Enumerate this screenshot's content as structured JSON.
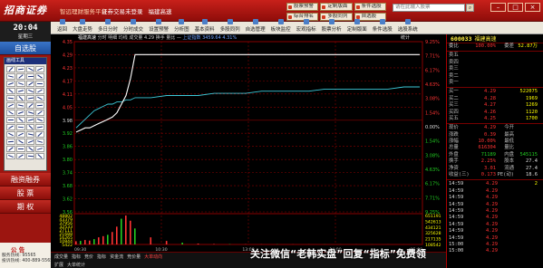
{
  "titlebar": {
    "logo": "招商证券",
    "subtitle": "智远理财服务平台",
    "menu": [
      "证券交易未登录",
      "福建高速"
    ],
    "quick_buttons": [
      "股票预警",
      "定制版面",
      "条件选股",
      "综合排名",
      "多股同列",
      "自选股"
    ],
    "search_placeholder": "请在此输入股票",
    "search_icon": "search-icon",
    "window_controls": [
      "min-icon",
      "max-icon",
      "close-icon"
    ]
  },
  "clock": {
    "time": "20:04",
    "day": "星期三"
  },
  "leftnav": {
    "top_item": "自选股",
    "tool_panel_title": "画线工具",
    "items": [
      "融资融券",
      "股 票",
      "期 权"
    ],
    "notice_title": "公 告",
    "phones": [
      "服务热线: 95565",
      "投诉热线: 400-889-5565"
    ]
  },
  "toolbar": {
    "items": [
      "返回",
      "大盘走势",
      "多日分时",
      "分时成交",
      "设置预警",
      "分析图",
      "基本资料",
      "多股同列",
      "自选管理",
      "板块监控",
      "宏观指标",
      "股票分析",
      "定制版面",
      "条件选股",
      "选股系统"
    ]
  },
  "chart_header": {
    "name": "福建高速",
    "mode": "分时 明细",
    "info": "均线 成交量 4.29 换手 量比 —",
    "index": "上证指数 3459.64 4.31%",
    "right_label": "统计"
  },
  "chart_data": {
    "type": "line",
    "title": "",
    "price_axis": [
      "4.35",
      "4.29",
      "4.23",
      "4.17",
      "4.11",
      "4.05",
      "3.98",
      "3.92",
      "3.86",
      "3.80",
      "3.74",
      "3.68",
      "3.62",
      "3.56"
    ],
    "pct_axis": [
      "9.25%",
      "7.71%",
      "6.17%",
      "4.63%",
      "3.08%",
      "1.54%",
      "0.00%",
      "1.54%",
      "3.08%",
      "4.63%",
      "6.17%",
      "7.71%",
      "9.25%"
    ],
    "volume_axis_left": [
      "48802",
      "43379",
      "37956",
      "32533",
      "27111",
      "21688",
      "16265",
      "10844",
      "5422"
    ],
    "volume_axis_right": [
      "651191",
      "542613",
      "434121",
      "325628",
      "217135",
      "108542"
    ],
    "x_labels": [
      "09:30",
      "10:30",
      "13:00",
      "14:00",
      "15:00"
    ],
    "prev_close": 3.98,
    "price_series": [
      3.93,
      3.94,
      3.95,
      3.95,
      3.96,
      3.97,
      3.98,
      3.99,
      4.0,
      4.02,
      4.06,
      4.1,
      4.18,
      4.29,
      4.29,
      4.29,
      4.29,
      4.29,
      4.29,
      4.29,
      4.29,
      4.29,
      4.29,
      4.29,
      4.29,
      4.29,
      4.29,
      4.29,
      4.29,
      4.29,
      4.29,
      4.29
    ],
    "avg_series": [
      3.95,
      3.97,
      3.99,
      4.01,
      4.03,
      4.04,
      4.05,
      4.06,
      4.06,
      4.07,
      4.07,
      4.08,
      4.08,
      4.09,
      4.09,
      4.1,
      4.1,
      4.1,
      4.11,
      4.11,
      4.11,
      4.12,
      4.12,
      4.12,
      4.12,
      4.13,
      4.13,
      4.13,
      4.13,
      4.13,
      4.14,
      4.14
    ],
    "volume_series": [
      5422,
      6000,
      7500,
      6500,
      9000,
      12000,
      14000,
      16265,
      21000,
      30000,
      43379,
      48802,
      40000,
      27000,
      12000,
      6000,
      3000,
      1500,
      800,
      500,
      400,
      300,
      300,
      200,
      200,
      200,
      150,
      150,
      150,
      100,
      100,
      100
    ]
  },
  "bottom_tabs": {
    "row1": [
      "成交量",
      "指标",
      "竞价",
      "指标",
      "资金流",
      "竞价量",
      "大单动向"
    ],
    "row2": [
      "扩展",
      "大单统计"
    ]
  },
  "quote": {
    "code": "600033",
    "name": "福建高速",
    "header_rows": [
      {
        "label": "委比",
        "value": "100.00%",
        "qty_label": "委差",
        "qty": "52.87万"
      }
    ],
    "sell": [
      {
        "label": "卖五",
        "price": "",
        "qty": ""
      },
      {
        "label": "卖四",
        "price": "",
        "qty": ""
      },
      {
        "label": "卖三",
        "price": "",
        "qty": ""
      },
      {
        "label": "卖二",
        "price": "",
        "qty": ""
      },
      {
        "label": "卖一",
        "price": "",
        "qty": ""
      }
    ],
    "buy": [
      {
        "label": "买一",
        "price": "4.29",
        "qty": "522075"
      },
      {
        "label": "买二",
        "price": "4.28",
        "qty": "1969"
      },
      {
        "label": "买三",
        "price": "4.27",
        "qty": "1269"
      },
      {
        "label": "买四",
        "price": "4.26",
        "qty": "1120"
      },
      {
        "label": "买五",
        "price": "4.25",
        "qty": "1700"
      }
    ],
    "stats": [
      {
        "l1": "现价",
        "v1": "4.29",
        "l2": "今开",
        "v2": ""
      },
      {
        "l1": "涨跌",
        "v1": "0.39",
        "l2": "最高",
        "v2": ""
      },
      {
        "l1": "涨幅",
        "v1": "10.00%",
        "l2": "最低",
        "v2": ""
      },
      {
        "l1": "总量",
        "v1": "616304",
        "l2": "量比",
        "v2": ""
      },
      {
        "l1": "外盘",
        "v1": "71189",
        "l2": "内盘",
        "v2": "545115"
      },
      {
        "l1": "换手",
        "v1": "2.25%",
        "l2": "股本",
        "v2": "27.4"
      },
      {
        "l1": "净资",
        "v1": "3.01",
        "l2": "流通",
        "v2": "27.4"
      },
      {
        "l1": "收益(三)",
        "v1": "0.173",
        "l2": "PE(动)",
        "v2": "18.6"
      }
    ],
    "ticks": [
      {
        "time": "14:59",
        "price": "4.29",
        "vol": "2"
      },
      {
        "time": "14:59",
        "price": "4.29",
        "vol": ""
      },
      {
        "time": "14:59",
        "price": "4.29",
        "vol": ""
      },
      {
        "time": "14:59",
        "price": "4.29",
        "vol": ""
      },
      {
        "time": "14:59",
        "price": "4.29",
        "vol": ""
      },
      {
        "time": "14:59",
        "price": "4.29",
        "vol": ""
      },
      {
        "time": "14:59",
        "price": "4.29",
        "vol": ""
      },
      {
        "time": "14:59",
        "price": "4.29",
        "vol": ""
      },
      {
        "time": "14:59",
        "price": "4.29",
        "vol": ""
      },
      {
        "time": "15:00",
        "price": "4.29",
        "vol": ""
      },
      {
        "time": "15:00",
        "price": "4.29",
        "vol": ""
      }
    ]
  },
  "watermark": "关注微信“老韩实盘”回复“指标”免费领",
  "colors": {
    "up": "#ff3333",
    "down": "#22cc22",
    "price_line": "#ffffff",
    "avg_line": "#3cc8d8",
    "grid": "#8a0000"
  }
}
